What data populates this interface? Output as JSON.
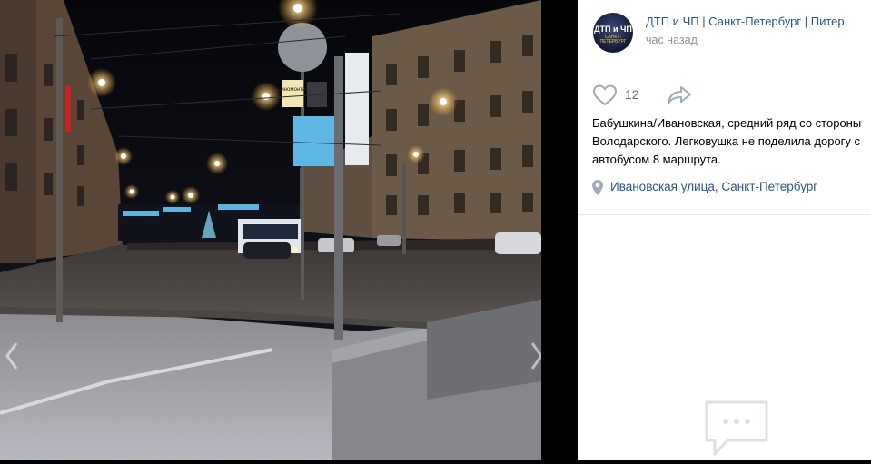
{
  "post": {
    "group_name": "ДТП и ЧП | Санкт-Петербург | Питер",
    "time": "час назад",
    "avatar_text": "ДТП и ЧП",
    "avatar_sub": "САНКТ-ПЕТЕРБУРГ",
    "likes": "12",
    "text": "Бабушкина/Ивановская, средний ряд со стороны Володарского. Легковушка не поделила дорогу с автобусом 8 маршрута.",
    "location": "Ивановская улица, Санкт-Петербург"
  },
  "photo": {
    "sign_text": "Шиномонтаж"
  },
  "colors": {
    "link": "#2a5885",
    "muted": "#939393",
    "icon": "#a0aabb"
  },
  "icons": [
    "heart-icon",
    "share-arrow-icon",
    "location-pin-icon",
    "comments-empty-icon",
    "nav-prev-icon",
    "nav-next-icon"
  ]
}
